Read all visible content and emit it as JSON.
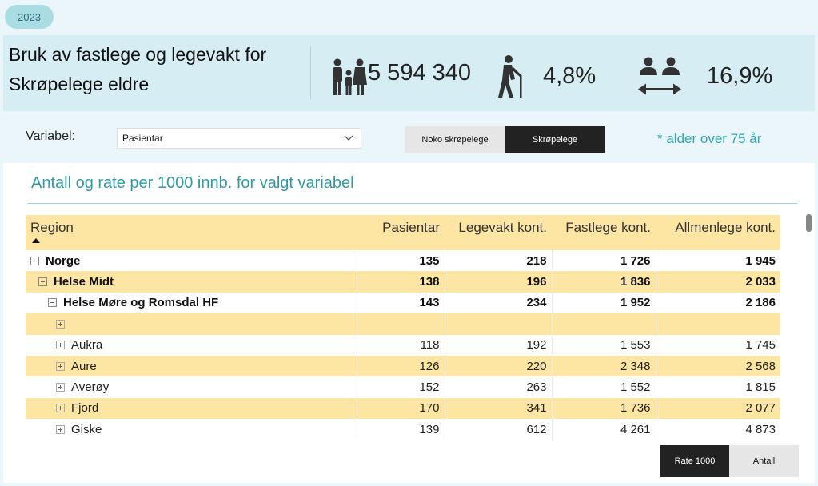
{
  "year": "2023",
  "banner": {
    "title_line1": "Bruk av fastlege og legevakt for",
    "title_line2": "Skrøpelege eldre",
    "kpis": [
      {
        "icon": "family-icon",
        "value": "5 594 340"
      },
      {
        "icon": "elderly-walker-icon",
        "value": "4,8%"
      },
      {
        "icon": "people-exchange-icon",
        "value": "16,9%"
      }
    ]
  },
  "controls": {
    "variable_label": "Variabel:",
    "variable_value": "Pasientar",
    "toggle": {
      "option_a": "Noko skrøpelege",
      "option_b": "Skrøpelege",
      "selected": "Skrøpelege"
    },
    "note": "* alder over 75 år"
  },
  "panel": {
    "title": "Antall og rate per 1000 innb. for valgt variabel",
    "columns": [
      "Region",
      "Pasientar",
      "Legevakt kont.",
      "Fastlege kont.",
      "Allmenlege kont."
    ],
    "rows": [
      {
        "name": "Norge",
        "level": 0,
        "expander": "minus",
        "bold": true,
        "values": [
          "135",
          "218",
          "1 726",
          "1 945"
        ]
      },
      {
        "name": "Helse Midt",
        "level": 1,
        "expander": "minus",
        "bold": true,
        "values": [
          "138",
          "196",
          "1 836",
          "2 033"
        ]
      },
      {
        "name": "Helse Møre og Romsdal HF",
        "level": 2,
        "expander": "minus",
        "bold": true,
        "values": [
          "143",
          "234",
          "1 952",
          "2 186"
        ]
      },
      {
        "name": "",
        "level": 3,
        "expander": "plus",
        "bold": false,
        "values": [
          "",
          "",
          "",
          ""
        ]
      },
      {
        "name": "Aukra",
        "level": 3,
        "expander": "plus",
        "bold": false,
        "values": [
          "118",
          "192",
          "1 553",
          "1 745"
        ]
      },
      {
        "name": "Aure",
        "level": 3,
        "expander": "plus",
        "bold": false,
        "values": [
          "126",
          "220",
          "2 348",
          "2 568"
        ]
      },
      {
        "name": "Averøy",
        "level": 3,
        "expander": "plus",
        "bold": false,
        "values": [
          "152",
          "263",
          "1 552",
          "1 815"
        ]
      },
      {
        "name": "Fjord",
        "level": 3,
        "expander": "plus",
        "bold": false,
        "values": [
          "170",
          "341",
          "1 736",
          "2 077"
        ]
      },
      {
        "name": "Giske",
        "level": 3,
        "expander": "plus",
        "bold": false,
        "values": [
          "139",
          "612",
          "4 261",
          "4 873"
        ]
      }
    ]
  },
  "buttons": {
    "rate": "Rate 1000",
    "antall": "Antall",
    "selected": "Rate 1000"
  },
  "colors": {
    "accent_teal": "#2f9aa6",
    "row_highlight": "#fde6a3",
    "banner_bg": "#d6eef3",
    "dark_button": "#222222"
  }
}
